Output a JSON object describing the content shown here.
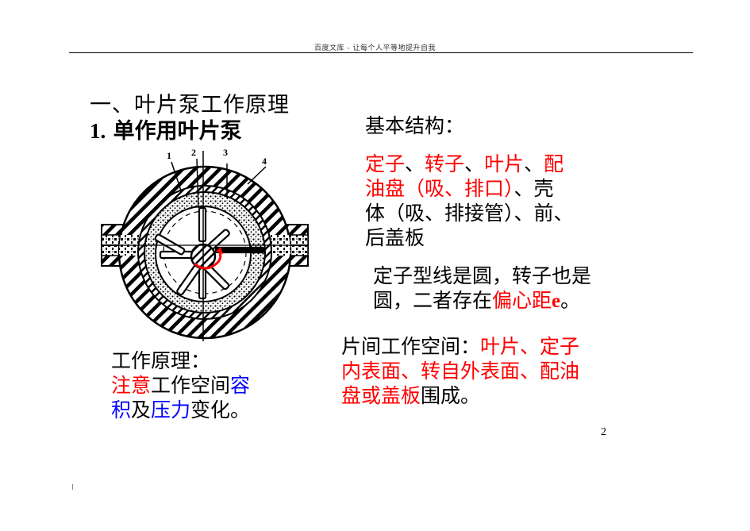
{
  "header": {
    "text": "百度文库 - 让每个人平等地提升自我"
  },
  "title": {
    "section": "一、叶片泵工作原理",
    "subsection_number": "1.",
    "subsection_text": "单作用叶片泵"
  },
  "basic_structure": {
    "heading": "基本结构：",
    "lines": [
      [
        {
          "text": "定子",
          "color": "red"
        },
        {
          "text": "、",
          "color": "black"
        },
        {
          "text": "转子",
          "color": "red"
        },
        {
          "text": "、",
          "color": "black"
        },
        {
          "text": "叶片",
          "color": "red"
        },
        {
          "text": "、",
          "color": "black"
        },
        {
          "text": "配",
          "color": "red"
        }
      ],
      [
        {
          "text": "油盘（吸、排口）",
          "color": "red"
        },
        {
          "text": "、壳",
          "color": "black"
        }
      ],
      [
        {
          "text": "体（吸、排接管）、前、",
          "color": "black"
        }
      ],
      [
        {
          "text": "后盖板",
          "color": "black"
        }
      ]
    ]
  },
  "profile_note": {
    "line1": "定子型线是圆，转子也是",
    "line2_prefix": "圆，二者存在",
    "line2_highlight": "偏心距",
    "line2_e": "e",
    "line2_suffix": "。"
  },
  "working_space": {
    "lines": [
      [
        {
          "text": "片间工作空间：",
          "color": "black"
        },
        {
          "text": "叶片、定子",
          "color": "red"
        }
      ],
      [
        {
          "text": "内表面、转自外表面、配油",
          "color": "red"
        }
      ],
      [
        {
          "text": "盘或盖板",
          "color": "red"
        },
        {
          "text": "围成。",
          "color": "black"
        }
      ]
    ]
  },
  "working_principle": {
    "heading": "工作原理：",
    "lines": [
      [
        {
          "text": "注意",
          "color": "red"
        },
        {
          "text": "工作空间",
          "color": "black"
        },
        {
          "text": "容",
          "color": "blue"
        }
      ],
      [
        {
          "text": "积",
          "color": "blue"
        },
        {
          "text": "及",
          "color": "black"
        },
        {
          "text": "压力",
          "color": "blue"
        },
        {
          "text": "变化。",
          "color": "black"
        }
      ]
    ]
  },
  "diagram": {
    "labels": [
      "1",
      "2",
      "3",
      "4"
    ],
    "arrow_color": "#ff0000"
  },
  "page_number": "2",
  "colors": {
    "red": "#ff0000",
    "blue": "#0000ff",
    "black": "#000000"
  }
}
